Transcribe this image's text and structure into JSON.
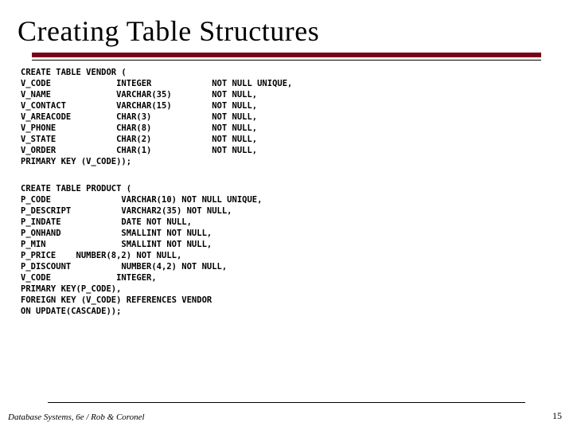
{
  "title": "Creating Table Structures",
  "sql_vendor": "CREATE TABLE VENDOR (\nV_CODE             INTEGER            NOT NULL UNIQUE,\nV_NAME             VARCHAR(35)        NOT NULL,\nV_CONTACT          VARCHAR(15)        NOT NULL,\nV_AREACODE         CHAR(3)            NOT NULL,\nV_PHONE            CHAR(8)            NOT NULL,\nV_STATE            CHAR(2)            NOT NULL,\nV_ORDER            CHAR(1)            NOT NULL,\nPRIMARY KEY (V_CODE));",
  "sql_product": "CREATE TABLE PRODUCT (\nP_CODE              VARCHAR(10) NOT NULL UNIQUE,\nP_DESCRIPT          VARCHAR2(35) NOT NULL,\nP_INDATE            DATE NOT NULL,\nP_ONHAND            SMALLINT NOT NULL,\nP_MIN               SMALLINT NOT NULL,\nP_PRICE    NUMBER(8,2) NOT NULL,\nP_DISCOUNT          NUMBER(4,2) NOT NULL,\nV_CODE             INTEGER,\nPRIMARY KEY(P_CODE),\nFOREIGN KEY (V_CODE) REFERENCES VENDOR\nON UPDATE(CASCADE));",
  "footer_left": "Database Systems, 6e / Rob & Coronel",
  "footer_right": "15"
}
